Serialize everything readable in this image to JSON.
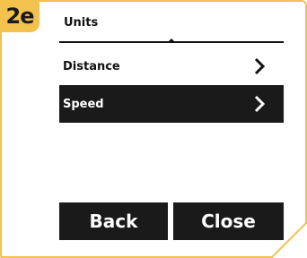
{
  "step_badge": "2e",
  "header": {
    "title": "Units"
  },
  "menu": {
    "items": [
      {
        "label": "Distance",
        "selected": false,
        "icon": "chevron-right-icon"
      },
      {
        "label": "Speed",
        "selected": true,
        "icon": "chevron-right-icon"
      }
    ]
  },
  "buttons": {
    "back_label": "Back",
    "close_label": "Close"
  },
  "colors": {
    "accent": "#f2c14e",
    "selected_bg": "#1a1a1a",
    "button_bg": "#1a1a1a"
  }
}
